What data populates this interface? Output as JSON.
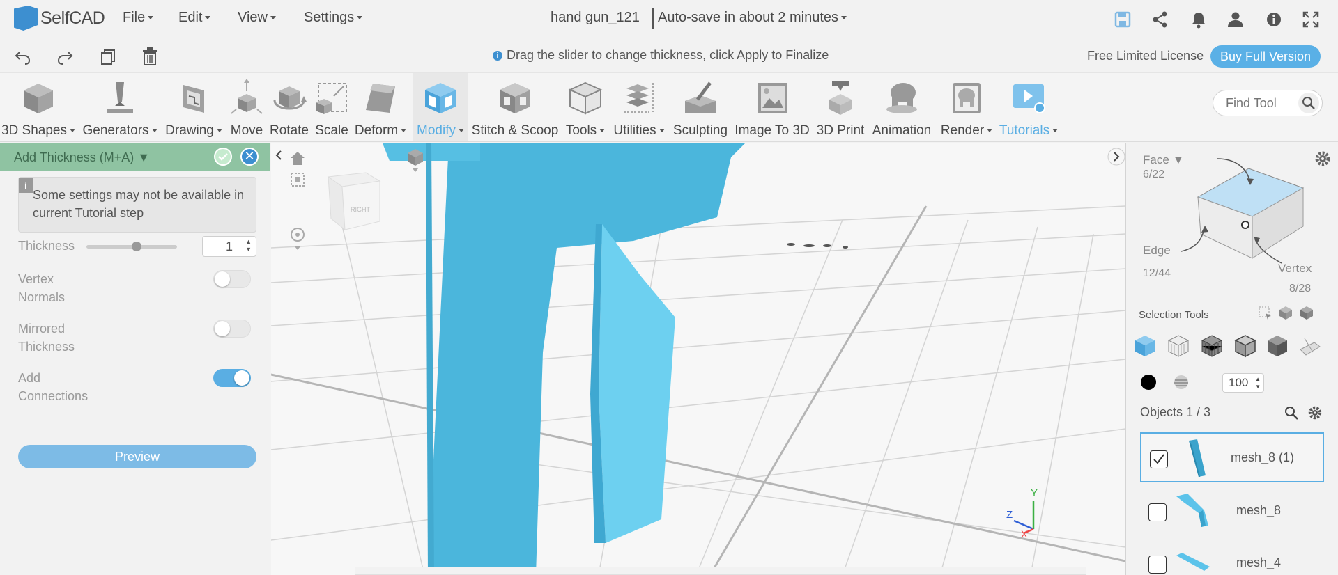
{
  "app": {
    "name": "SelfCAD",
    "title": "hand gun_121",
    "autosave": "Auto-save in about 2 minutes"
  },
  "menu": {
    "file": "File",
    "edit": "Edit",
    "view": "View",
    "settings": "Settings"
  },
  "hint": "Drag the slider to change thickness, click Apply to Finalize",
  "license": {
    "label": "Free Limited License",
    "buy": "Buy Full Version"
  },
  "toolbar": {
    "tools": [
      "3D Shapes",
      "Generators",
      "Drawing",
      "Move",
      "Rotate",
      "Scale",
      "Deform",
      "Modify",
      "Stitch & Scoop",
      "Tools",
      "Utilities",
      "Sculpting",
      "Image To 3D",
      "3D Print",
      "Animation",
      "Render",
      "Tutorials"
    ],
    "find_placeholder": "Find Tool"
  },
  "panel": {
    "title": "Add Thickness (M+A)",
    "note": "Some settings may not be available in current Tutorial step",
    "thickness_label": "Thickness",
    "thickness_value": "1",
    "thickness_slider": 0.55,
    "vertex_label_1": "Vertex",
    "vertex_label_2": "Normals",
    "mirrored_label_1": "Mirrored",
    "mirrored_label_2": "Thickness",
    "connections_label_1": "Add",
    "connections_label_2": "Connections",
    "vertex_normals_on": false,
    "mirrored_on": false,
    "add_connections_on": true,
    "preview": "Preview"
  },
  "viewcube": {
    "right": "RIGHT"
  },
  "axes": {
    "y": "Y",
    "z": "Z",
    "x": "X"
  },
  "right": {
    "face_label": "Face",
    "face_count": "6/22",
    "edge_label": "Edge",
    "edge_count": "12/44",
    "vertex_label": "Vertex",
    "vertex_count": "8/28",
    "selection_tools": "Selection Tools",
    "opacity_value": "100",
    "objects_label": "Objects 1 / 3",
    "objects": [
      {
        "name": "mesh_8 (1)",
        "checked": true
      },
      {
        "name": "mesh_8",
        "checked": false
      },
      {
        "name": "mesh_4",
        "checked": false
      }
    ]
  },
  "colors": {
    "accent": "#5aaee3",
    "model": "#4bb6dc",
    "panel_header": "#8fc3a2"
  }
}
